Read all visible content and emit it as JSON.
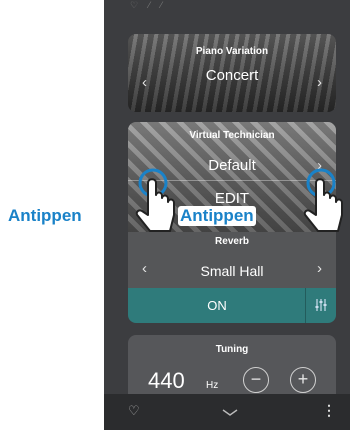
{
  "piano_variation": {
    "title": "Piano Variation",
    "value": "Concert",
    "prev_icon": "chevron-left-icon",
    "next_icon": "chevron-right-icon"
  },
  "virtual_technician": {
    "title": "Virtual Technician",
    "value": "Default",
    "edit_label": "EDIT"
  },
  "reverb": {
    "title": "Reverb",
    "value": "Small Hall",
    "toggle_label": "ON",
    "settings_icon": "sliders-icon"
  },
  "tuning": {
    "title": "Tuning",
    "value": "440",
    "unit": "Hz",
    "decrease_symbol": "−",
    "increase_symbol": "+"
  },
  "bottom_bar": {
    "favorite_icon": "heart-icon",
    "collapse_icon": "chevron-down-icon",
    "menu_icon": "more-vertical-icon"
  },
  "annotations": {
    "tap_label_1": "Antippen",
    "tap_label_2": "Antippen"
  },
  "colors": {
    "accent": "#2f7b7b",
    "annotation": "#1a82c8"
  }
}
